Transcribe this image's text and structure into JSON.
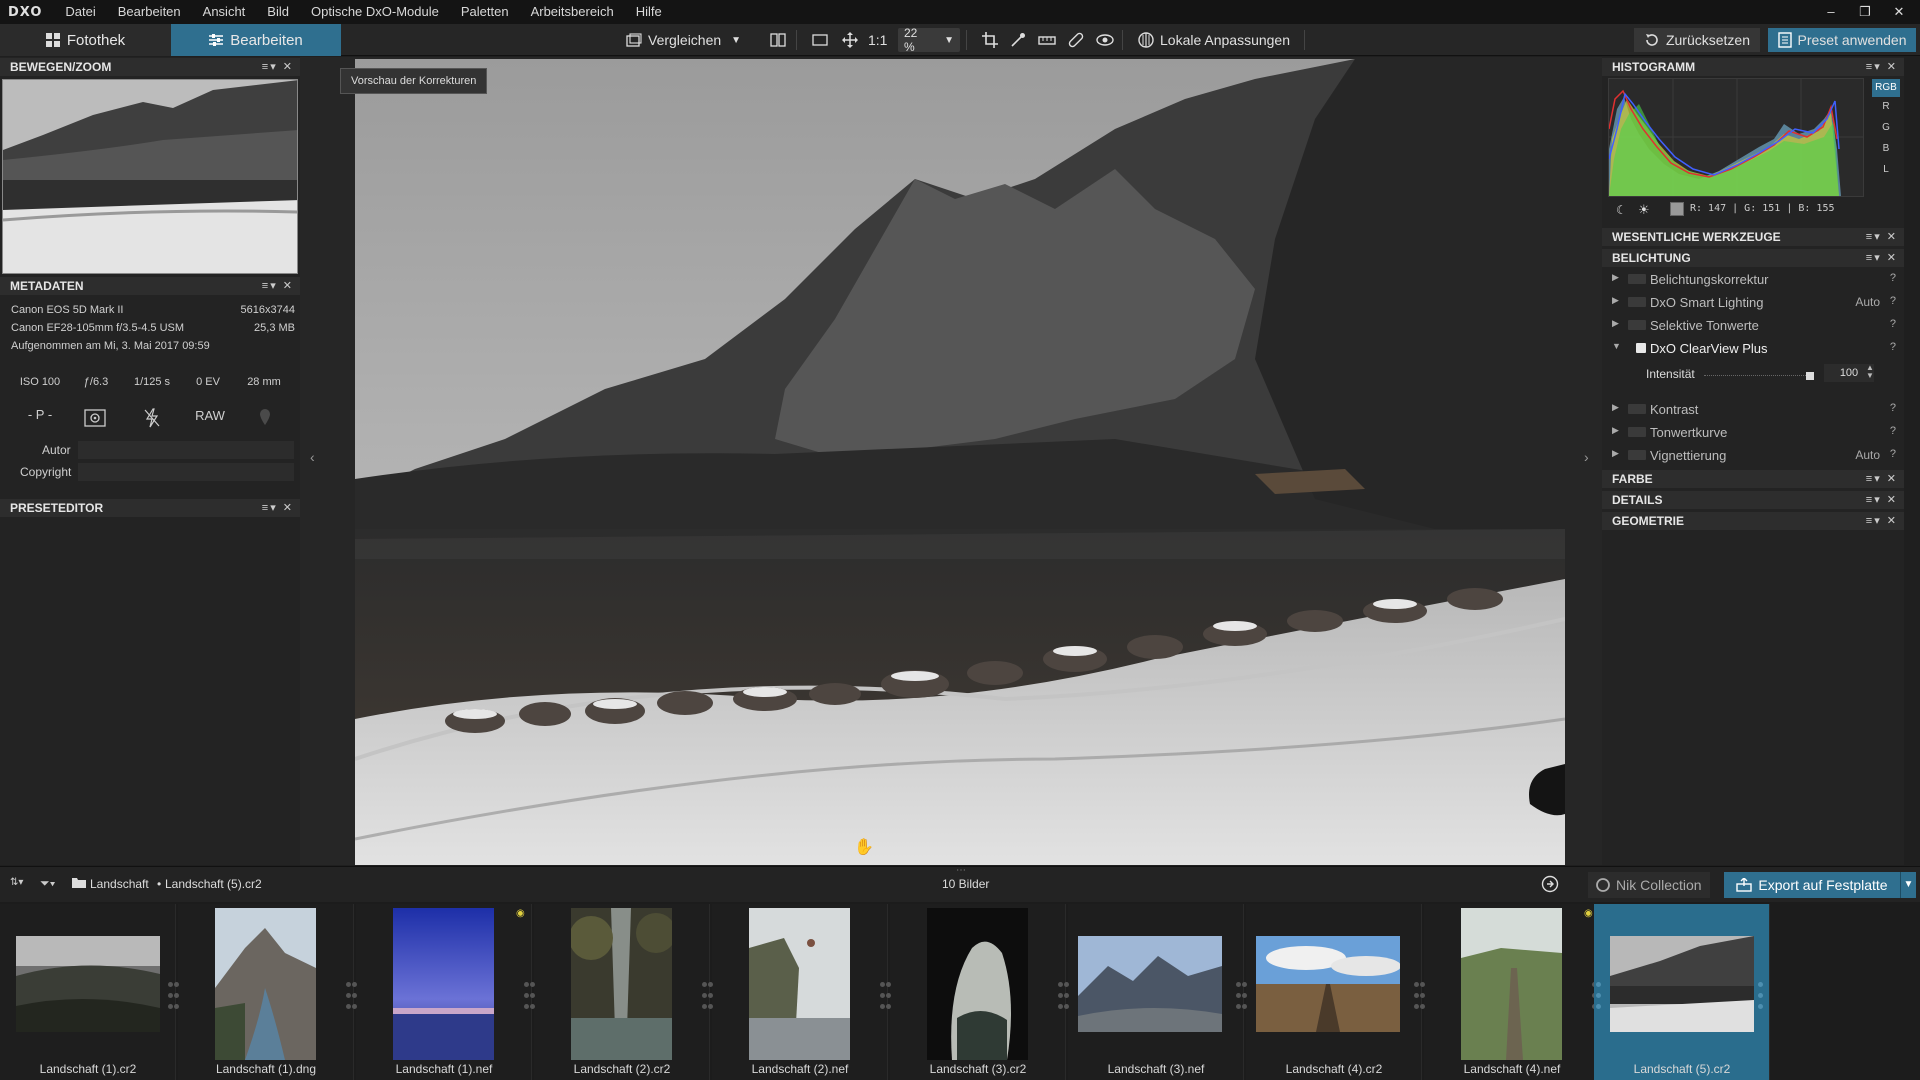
{
  "app": {
    "logo": "DXO",
    "menu": [
      "Datei",
      "Bearbeiten",
      "Ansicht",
      "Bild",
      "Optische DxO-Module",
      "Paletten",
      "Arbeitsbereich",
      "Hilfe"
    ]
  },
  "toolbar": {
    "tab_library": "Fotothek",
    "tab_edit": "Bearbeiten",
    "compare": "Vergleichen",
    "ratio_1_1": "1:1",
    "zoom": "22 %",
    "local_adjust": "Lokale Anpassungen",
    "reset": "Zurücksetzen",
    "apply_preset": "Preset anwenden"
  },
  "left": {
    "move_zoom_title": "BEWEGEN/ZOOM",
    "metadata_title": "METADATEN",
    "camera": "Canon EOS 5D Mark II",
    "dimensions": "5616x3744",
    "lens": "Canon EF28-105mm f/3.5-4.5 USM",
    "filesize": "25,3 MB",
    "taken": "Aufgenommen am Mi, 3. Mai 2017 09:59",
    "iso": "ISO 100",
    "aperture": "ƒ/6.3",
    "shutter": "1/125 s",
    "ev": "0 EV",
    "focal": "28 mm",
    "mode": "- P -",
    "raw": "RAW",
    "author_label": "Autor",
    "copyright_label": "Copyright",
    "preset_editor_title": "PRESETEDITOR"
  },
  "viewer": {
    "tooltip": "Vorschau der Korrekturen"
  },
  "right": {
    "histogram_title": "HISTOGRAMM",
    "channels": [
      "RGB",
      "R",
      "G",
      "B",
      "L"
    ],
    "rgb_readout": "R: 147 | G: 151 | B: 155",
    "essential_title": "WESENTLICHE WERKZEUGE",
    "exposure_title": "BELICHTUNG",
    "tools": [
      {
        "label": "Belichtungskorrektur",
        "auto": ""
      },
      {
        "label": "DxO Smart Lighting",
        "auto": "Auto"
      },
      {
        "label": "Selektive Tonwerte",
        "auto": ""
      },
      {
        "label": "DxO ClearView Plus",
        "auto": ""
      },
      {
        "label": "Kontrast",
        "auto": ""
      },
      {
        "label": "Tonwertkurve",
        "auto": ""
      },
      {
        "label": "Vignettierung",
        "auto": "Auto"
      }
    ],
    "intensity_label": "Intensität",
    "intensity_value": "100",
    "intensity_level": 1.0,
    "color_title": "FARBE",
    "details_title": "DETAILS",
    "geometry_title": "GEOMETRIE",
    "help_glyph": "?"
  },
  "filmbar": {
    "folder": "Landschaft",
    "separator": "•",
    "file": "Landschaft (5).cr2",
    "count": "10 Bilder",
    "nik": "Nik Collection",
    "export": "Export auf Festplatte"
  },
  "thumbnails": [
    {
      "label": "Landschaft (1).cr2"
    },
    {
      "label": "Landschaft (1).dng"
    },
    {
      "label": "Landschaft (1).nef"
    },
    {
      "label": "Landschaft (2).cr2"
    },
    {
      "label": "Landschaft (2).nef"
    },
    {
      "label": "Landschaft (3).cr2"
    },
    {
      "label": "Landschaft (3).nef"
    },
    {
      "label": "Landschaft (4).cr2"
    },
    {
      "label": "Landschaft (4).nef"
    },
    {
      "label": "Landschaft (5).cr2"
    }
  ],
  "colors": {
    "accent": "#2f6f8f",
    "panel": "#232323",
    "header": "#2d2d2d"
  }
}
